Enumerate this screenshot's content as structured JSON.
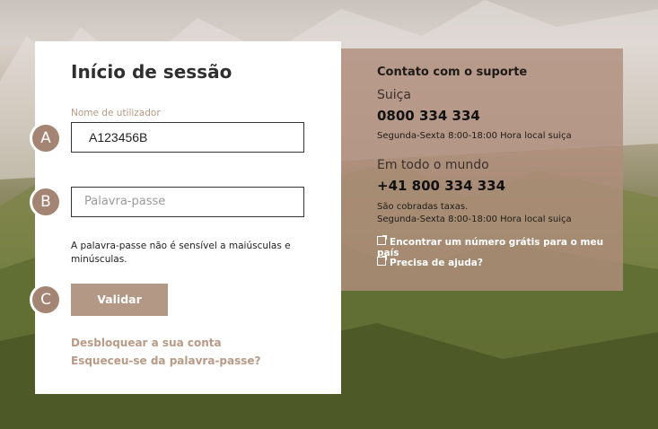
{
  "login": {
    "title": "Início de sessão",
    "username_label": "Nome de utilizador",
    "username_value": "A123456B",
    "password_placeholder": "Palavra-passe",
    "hint": "A palavra-passe não é sensível a maiúsculas e minúsculas.",
    "validate_label": "Validar",
    "unlock_label": "Desbloquear a sua conta",
    "forgot_label": "Esqueceu-se da palavra-passe?"
  },
  "badges": [
    "A",
    "B",
    "C"
  ],
  "support": {
    "title": "Contato com o suporte",
    "region_switzerland": "Suiça",
    "phone_switzerland": "0800 334 334",
    "hours_switzerland": "Segunda-Sexta 8:00-18:00 Hora local suiça",
    "region_world": "Em todo o mundo",
    "phone_world": "+41 800 334 334",
    "fee_note": "São cobradas taxas.",
    "hours_world": "Segunda-Sexta 8:00-18:00 Hora local suiça",
    "free_number_link": "Encontrar um número grátis para o meu país",
    "help_link": "Precisa de ajuda?"
  },
  "colors": {
    "accent": "#b39886",
    "badge": "#a48472",
    "support_panel": "#b08e7c"
  },
  "icons": [
    "external-link-icon"
  ]
}
